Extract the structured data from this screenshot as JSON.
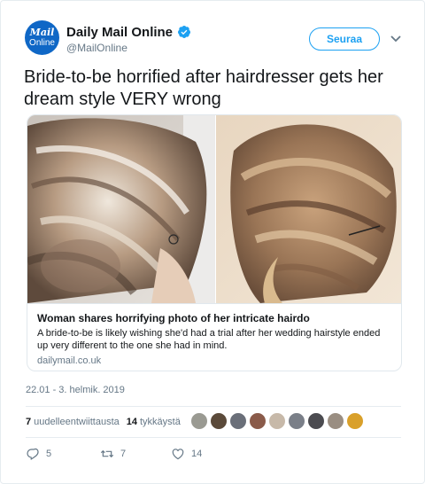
{
  "account": {
    "name": "Daily Mail Online",
    "handle": "@MailOnline",
    "avatar_line1": "Mail",
    "avatar_line2": "Online",
    "verified_icon": "verified-badge-icon",
    "brand_color": "#0f67c6"
  },
  "follow_button": {
    "label": "Seuraa",
    "color": "#1da1f2"
  },
  "tweet": {
    "text": "Bride-to-be horrified after hairdresser gets her dream style VERY wrong"
  },
  "card": {
    "title": "Woman shares horrifying photo of her intricate hairdo",
    "description": "A bride-to-be is likely wishing she'd had a trial after her wedding hairstyle ended up very different to the one she had in mind.",
    "domain": "dailymail.co.uk"
  },
  "timestamp": "22.01 - 3. helmik. 2019",
  "stats": {
    "retweets_count": "7",
    "retweets_label": "uudelleentwiittausta",
    "likes_count": "14",
    "likes_label": "tykkäystä"
  },
  "actions": {
    "replies": "5",
    "retweets": "7",
    "likes": "14"
  },
  "liker_avatar_colors": [
    "#9a9a92",
    "#5b4a3a",
    "#6a6f79",
    "#8a5b4a",
    "#c7b9a9",
    "#7a7f88",
    "#4b4b50",
    "#9a8e82",
    "#d9a02a"
  ],
  "icons": [
    "verified-badge-icon",
    "chevron-down-icon",
    "reply-icon",
    "retweet-icon",
    "like-icon"
  ]
}
